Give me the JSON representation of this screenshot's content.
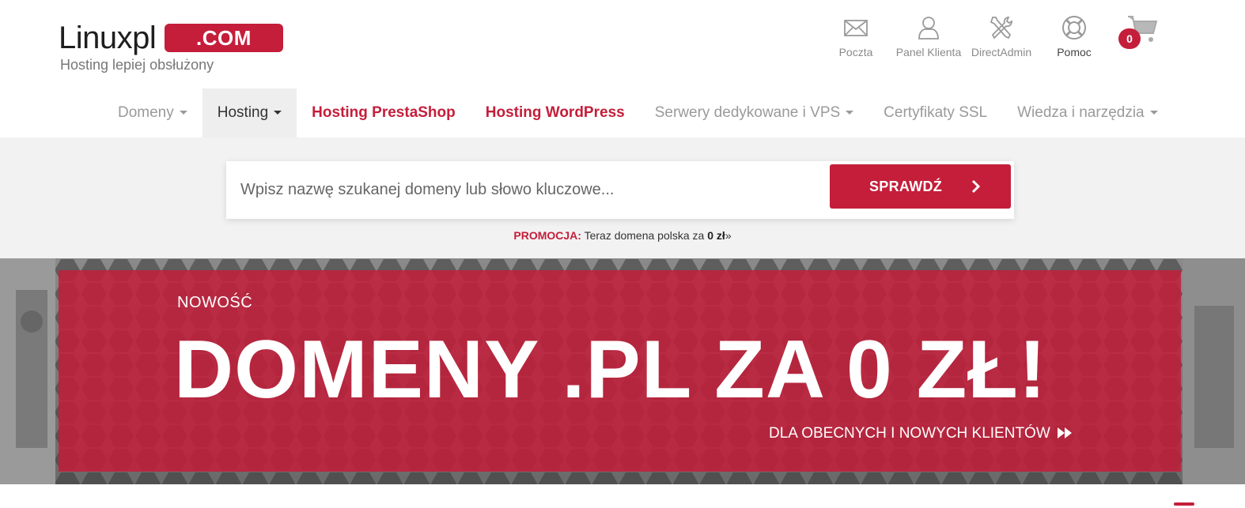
{
  "brand": {
    "name": "Linuxpl",
    "badge": ".COM",
    "tagline": "Hosting lepiej obsłużony",
    "accent_color": "#c41e3a"
  },
  "top_links": [
    {
      "label": "Poczta",
      "icon": "envelope-icon"
    },
    {
      "label": "Panel Klienta",
      "icon": "user-icon"
    },
    {
      "label": "DirectAdmin",
      "icon": "tools-icon"
    },
    {
      "label": "Pomoc",
      "icon": "lifebuoy-icon"
    }
  ],
  "cart": {
    "count": "0",
    "icon": "cart-icon"
  },
  "nav": [
    {
      "label": "Domeny",
      "dropdown": true
    },
    {
      "label": "Hosting",
      "dropdown": true,
      "active": true
    },
    {
      "label": "Hosting PrestaShop",
      "dropdown": false
    },
    {
      "label": "Hosting WordPress",
      "dropdown": false
    },
    {
      "label": "Serwery dedykowane i VPS",
      "dropdown": true
    },
    {
      "label": "Certyfikaty SSL",
      "dropdown": false
    },
    {
      "label": "Wiedza i narzędzia",
      "dropdown": true
    }
  ],
  "search": {
    "placeholder": "Wpisz nazwę szukanej domeny lub słowo kluczowe...",
    "button_label": "SPRAWDŹ"
  },
  "promo": {
    "key": "PROMOCJA:",
    "text": "Teraz domena polska za",
    "price": "0 zł",
    "arrow": "»"
  },
  "hero": {
    "eyebrow": "NOWOŚĆ",
    "title": "DOMENY .PL ZA 0 ZŁ!",
    "subtitle": "DLA OBECNYCH I NOWYCH KLIENTÓW"
  }
}
